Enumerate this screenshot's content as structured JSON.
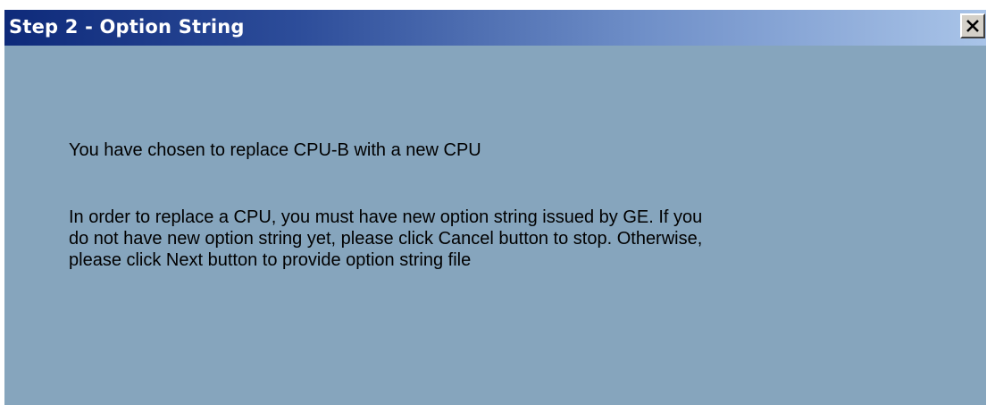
{
  "window": {
    "title": "Step 2 - Option String",
    "close_label": "×"
  },
  "content": {
    "line1": "You have chosen to replace CPU-B with a new CPU",
    "paragraph_lines": [
      "In order to replace a CPU, you must have new option string issued by GE. If you",
      "do not have new option string yet, please click Cancel button to stop. Otherwise,",
      "please click Next button to provide option string file"
    ]
  },
  "colors": {
    "titlebar_start": "#0e2a7a",
    "titlebar_end": "#a9c4e8",
    "content_background": "#86a5bd"
  }
}
